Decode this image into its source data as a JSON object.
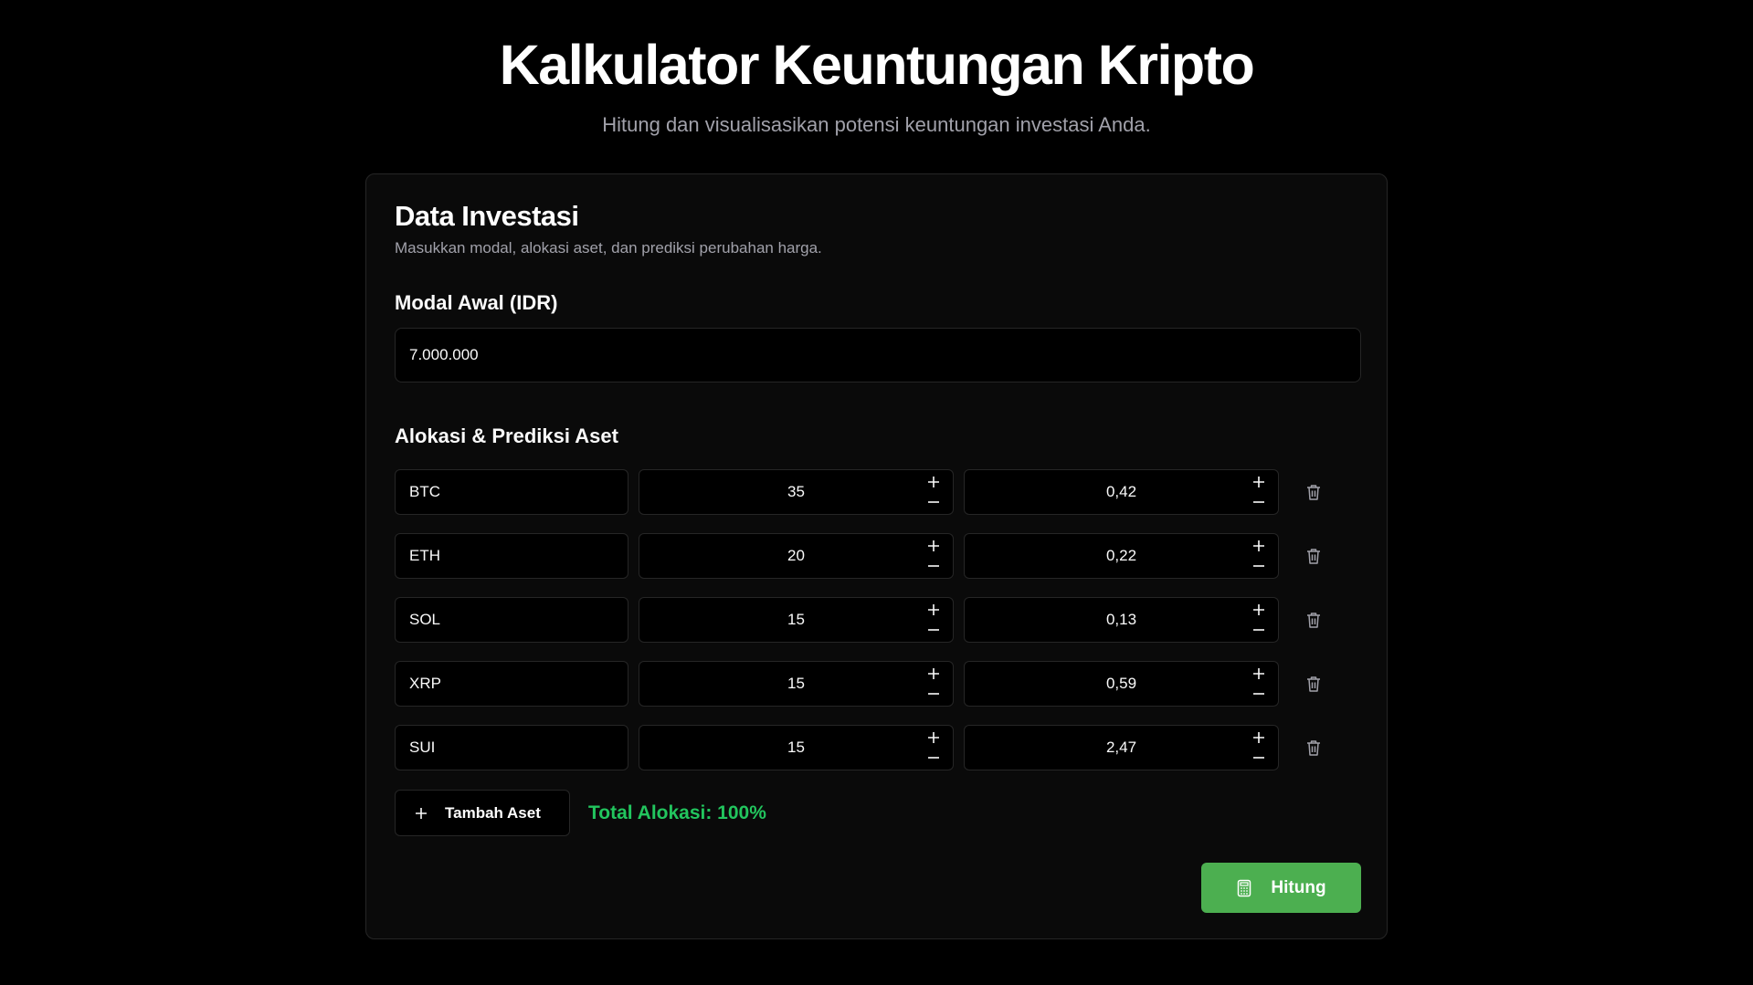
{
  "header": {
    "title": "Kalkulator Keuntungan Kripto",
    "subtitle": "Hitung dan visualisasikan potensi keuntungan investasi Anda."
  },
  "card": {
    "title": "Data Investasi",
    "description": "Masukkan modal, alokasi aset, dan prediksi perubahan harga."
  },
  "modal": {
    "label": "Modal Awal (IDR)",
    "value": "7.000.000"
  },
  "allocation": {
    "label": "Alokasi & Prediksi Aset",
    "assets": [
      {
        "name": "BTC",
        "percent": "35",
        "change": "0,42"
      },
      {
        "name": "ETH",
        "percent": "20",
        "change": "0,22"
      },
      {
        "name": "SOL",
        "percent": "15",
        "change": "0,13"
      },
      {
        "name": "XRP",
        "percent": "15",
        "change": "0,59"
      },
      {
        "name": "SUI",
        "percent": "15",
        "change": "2,47"
      }
    ]
  },
  "actions": {
    "add_label": "Tambah Aset",
    "total_text": "Total Alokasi: 100%",
    "calculate_label": "Hitung"
  },
  "colors": {
    "background": "#000000",
    "card": "#0a0a0a",
    "border": "#262626",
    "accent_green": "#22c55e",
    "button_green": "#4caf50"
  },
  "icons": {
    "plus": "plus-icon",
    "minus": "minus-icon",
    "trash": "trash-icon",
    "calculator": "calculator-icon"
  }
}
